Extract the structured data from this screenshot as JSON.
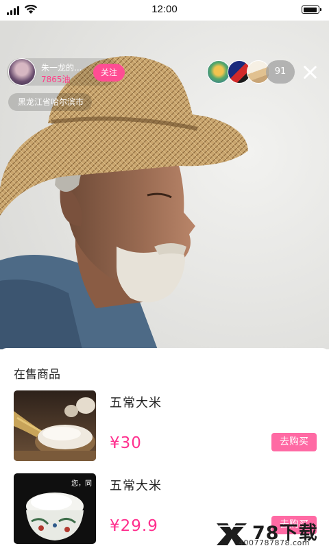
{
  "status_bar": {
    "time": "12:00"
  },
  "live": {
    "host": {
      "name": "朱一龙的...",
      "likes": "7865油"
    },
    "follow_label": "关注",
    "location": "黑龙江省哈尔滨市",
    "viewer_count": "91"
  },
  "products": {
    "title": "在售商品",
    "items": [
      {
        "name": "五常大米",
        "price": "¥30",
        "buy_label": "去购买"
      },
      {
        "name": "五常大米",
        "price": "¥29.9",
        "buy_label": "去购买",
        "thumb_caption": "您，同"
      }
    ]
  },
  "watermark": {
    "brand": "78下载",
    "phone": "4007787878.com"
  },
  "colors": {
    "accent": "#ff4d93",
    "price": "#ff2f8e",
    "buy_button": "#ff6aa4"
  }
}
